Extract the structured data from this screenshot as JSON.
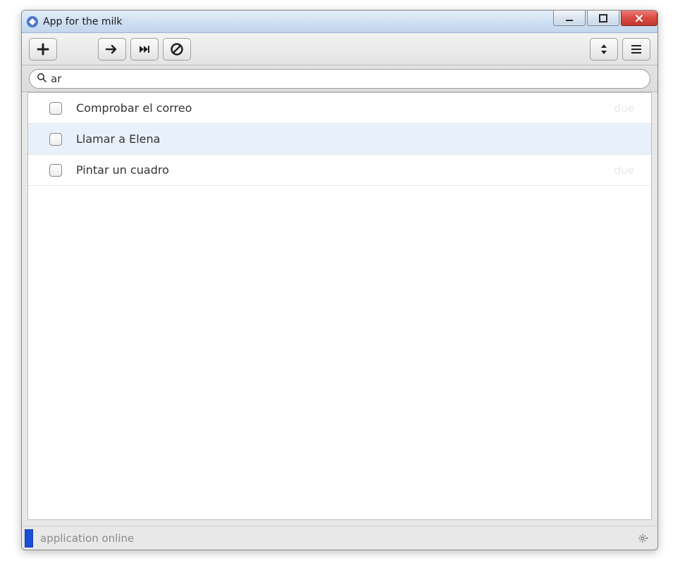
{
  "window": {
    "title": "App for the milk"
  },
  "toolbar": {
    "add_label": "+",
    "next_label": "→",
    "skip_label": "⏭",
    "cancel_label": "⊘",
    "sort_label": "⇅",
    "menu_label": "≡"
  },
  "search": {
    "value": "ar",
    "placeholder": ""
  },
  "tasks": [
    {
      "title": "Comprobar el correo",
      "due": "due",
      "checked": false,
      "selected": false
    },
    {
      "title": "Llamar a Elena",
      "due": "",
      "checked": false,
      "selected": true
    },
    {
      "title": "Pintar un cuadro",
      "due": "due",
      "checked": false,
      "selected": false
    }
  ],
  "status": {
    "text": "application online"
  }
}
